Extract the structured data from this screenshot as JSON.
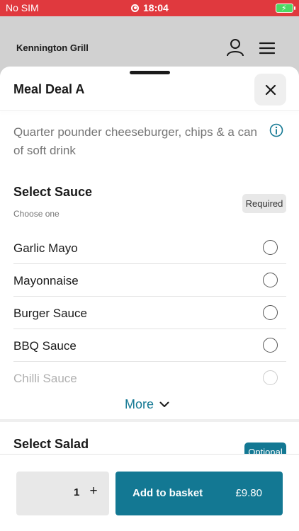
{
  "status_bar": {
    "carrier": "No SIM",
    "time": "18:04"
  },
  "header": {
    "restaurant_name": "Kennington Grill"
  },
  "sheet": {
    "title": "Meal Deal A",
    "description": "Quarter pounder cheeseburger, chips & a can of soft drink"
  },
  "sauce_section": {
    "title": "Select Sauce",
    "subtitle": "Choose one",
    "badge": "Required",
    "options": [
      {
        "label": "Garlic Mayo"
      },
      {
        "label": "Mayonnaise"
      },
      {
        "label": "Burger Sauce"
      },
      {
        "label": "BBQ Sauce"
      },
      {
        "label": "Chilli Sauce"
      }
    ],
    "more_label": "More"
  },
  "salad_section": {
    "title": "Select Salad",
    "badge": "Optional"
  },
  "basket": {
    "quantity": "1",
    "plus": "+",
    "add_label": "Add to basket",
    "price": "£9.80"
  },
  "colors": {
    "status_bar": "#e0393e",
    "accent": "#137893",
    "header_bg": "#d1d1d1"
  },
  "icons": [
    "recording-icon",
    "battery-icon",
    "account-icon",
    "menu-icon",
    "close-icon",
    "info-icon",
    "chevron-down-icon"
  ]
}
